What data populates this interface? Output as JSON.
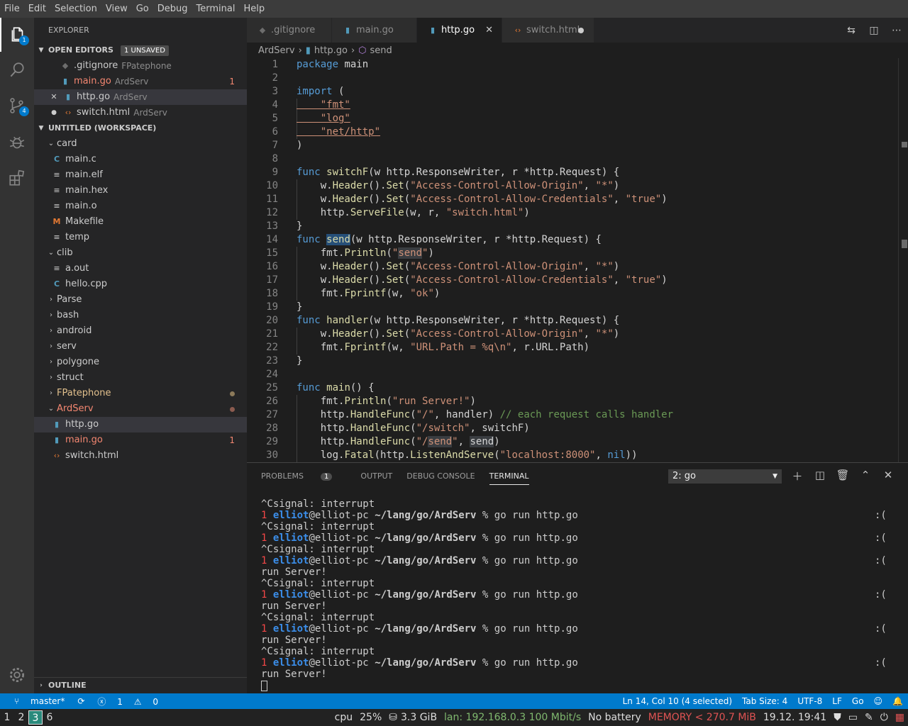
{
  "menu": [
    "File",
    "Edit",
    "Selection",
    "View",
    "Go",
    "Debug",
    "Terminal",
    "Help"
  ],
  "activity": {
    "explorer_badge": "1",
    "scm_badge": "4"
  },
  "sidebar": {
    "title": "EXPLORER",
    "open_editors": {
      "label": "OPEN EDITORS",
      "badge": "1 UNSAVED",
      "items": [
        {
          "name": ".gitignore",
          "desc": "FPatephone",
          "count": ""
        },
        {
          "name": "main.go",
          "desc": "ArdServ",
          "count": "1"
        },
        {
          "name": "http.go",
          "desc": "ArdServ",
          "count": ""
        },
        {
          "name": "switch.html",
          "desc": "ArdServ",
          "count": ""
        }
      ]
    },
    "workspace": {
      "label": "UNTITLED (WORKSPACE)",
      "items": [
        {
          "name": "card"
        },
        {
          "name": "main.c"
        },
        {
          "name": "main.elf"
        },
        {
          "name": "main.hex"
        },
        {
          "name": "main.o"
        },
        {
          "name": "Makefile"
        },
        {
          "name": "temp"
        },
        {
          "name": "clib"
        },
        {
          "name": "a.out"
        },
        {
          "name": "hello.cpp"
        },
        {
          "name": "Parse"
        },
        {
          "name": "bash"
        },
        {
          "name": "android"
        },
        {
          "name": "serv"
        },
        {
          "name": "polygone"
        },
        {
          "name": "struct"
        },
        {
          "name": "FPatephone"
        },
        {
          "name": "ArdServ"
        },
        {
          "name": "http.go"
        },
        {
          "name": "main.go",
          "count": "1"
        },
        {
          "name": "switch.html"
        }
      ]
    },
    "outline": "OUTLINE"
  },
  "tabs": [
    {
      "label": ".gitignore"
    },
    {
      "label": "main.go"
    },
    {
      "label": "http.go"
    },
    {
      "label": "switch.html"
    }
  ],
  "breadcrumb": {
    "folder": "ArdServ",
    "file": "http.go",
    "symbol": "send"
  },
  "editor": {
    "line_numbers": [
      "1",
      "2",
      "3",
      "4",
      "5",
      "6",
      "7",
      "8",
      "9",
      "10",
      "11",
      "12",
      "13",
      "14",
      "15",
      "16",
      "17",
      "18",
      "19",
      "20",
      "21",
      "22",
      "23",
      "24",
      "25",
      "26",
      "27",
      "28",
      "29",
      "30"
    ]
  },
  "panel": {
    "tabs": {
      "problems": "PROBLEMS",
      "problems_count": "1",
      "output": "OUTPUT",
      "debug": "DEBUG CONSOLE",
      "terminal": "TERMINAL"
    },
    "terminal_select": "2: go",
    "prompt": {
      "num": "1",
      "user": "elliot",
      "host": "@elliot-pc",
      "path": "~/lang/go/ArdServ",
      "cmd": " % go run http.go",
      "face": ":("
    },
    "interrupt": "^Csignal: interrupt",
    "run": "run Server!"
  },
  "status": {
    "branch": "master*",
    "errors": "1",
    "warnings": "0",
    "position": "Ln 14, Col 10 (4 selected)",
    "tab_size": "Tab Size: 4",
    "encoding": "UTF-8",
    "eol": "LF",
    "lang": "Go"
  },
  "polybar": {
    "ws": [
      "1",
      "2",
      "3",
      "6"
    ],
    "cpu_label": "cpu",
    "cpu": "25%",
    "disk": "3.3 GiB",
    "lan": "lan: 192.168.0.3 100 Mbit/s",
    "battery": "No battery",
    "memory": "MEMORY < 270.7 MiB",
    "clock": "19.12. 19:41"
  }
}
